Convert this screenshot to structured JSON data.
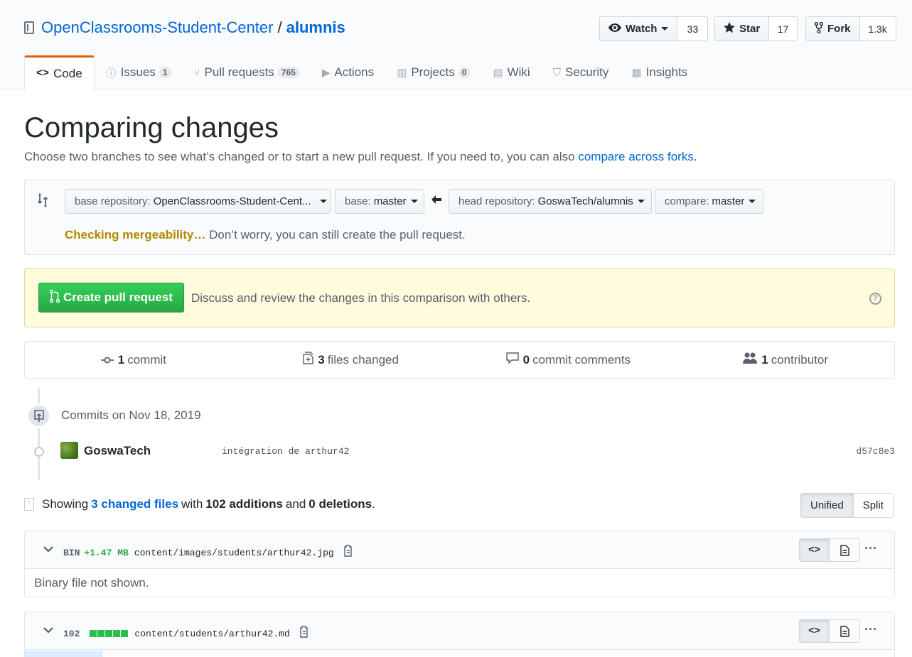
{
  "repo": {
    "owner": "OpenClassrooms-Student-Center",
    "separator": "/",
    "name": "alumnis"
  },
  "actions": {
    "watch": {
      "label": "Watch",
      "count": "33"
    },
    "star": {
      "label": "Star",
      "count": "17"
    },
    "fork": {
      "label": "Fork",
      "count": "1.3k"
    }
  },
  "tabs": [
    {
      "label": "Code",
      "icon": "code-icon",
      "glyph": "<>"
    },
    {
      "label": "Issues",
      "count": "1",
      "icon": "issue-icon",
      "glyph": "ⓘ"
    },
    {
      "label": "Pull requests",
      "count": "765",
      "icon": "pull-request-icon",
      "glyph": "⑂"
    },
    {
      "label": "Actions",
      "icon": "play-icon",
      "glyph": "▶"
    },
    {
      "label": "Projects",
      "count": "0",
      "icon": "project-icon",
      "glyph": "▥"
    },
    {
      "label": "Wiki",
      "icon": "book-icon",
      "glyph": "▤"
    },
    {
      "label": "Security",
      "icon": "shield-icon",
      "glyph": "⛉"
    },
    {
      "label": "Insights",
      "icon": "graph-icon",
      "glyph": "▦"
    }
  ],
  "page": {
    "title": "Comparing changes",
    "subtitle": "Choose two branches to see what’s changed or to start a new pull request. If you need to, you can also",
    "subtitle_link": "compare across forks."
  },
  "range": {
    "base_repo_label": "base repository:",
    "base_repo_value": "OpenClassrooms-Student-Cent...",
    "base_label": "base:",
    "base_value": "master",
    "head_repo_label": "head repository:",
    "head_repo_value": "GoswaTech/alumnis",
    "compare_label": "compare:",
    "compare_value": "master",
    "merge_status": "Checking mergeability…",
    "merge_note": "Don’t worry, you can still create the pull request."
  },
  "flash": {
    "button": "Create pull request",
    "description": "Discuss and review the changes in this comparison with others.",
    "help": "?"
  },
  "stats": {
    "commits": {
      "count": "1",
      "label": "commit"
    },
    "files": {
      "count": "3",
      "label": "files changed"
    },
    "comments": {
      "count": "0",
      "label": "commit comments"
    },
    "contributors": {
      "count": "1",
      "label": "contributor"
    }
  },
  "commits": {
    "date_heading": "Commits on Nov 18, 2019",
    "items": [
      {
        "author": "GoswaTech",
        "message": "intégration de arthur42",
        "sha": "d57c8e3"
      }
    ]
  },
  "toc": {
    "showing": "Showing",
    "changed_files": "3 changed files",
    "with": "with",
    "additions": "102 additions",
    "and": "and",
    "deletions": "0 deletions",
    "period": ".",
    "unified": "Unified",
    "split": "Split"
  },
  "files": [
    {
      "stat_label": "BIN",
      "stat_value": "+1.47 MB",
      "path": "content/images/students/arthur42.jpg",
      "body": "Binary file not shown."
    },
    {
      "stat_label": "102",
      "path": "content/students/arthur42.md",
      "diff_blocks": 5
    }
  ],
  "colors": {
    "link": "#0366d6",
    "green": "#28a745",
    "tab_accent": "#e36209",
    "warning": "#b08800"
  }
}
